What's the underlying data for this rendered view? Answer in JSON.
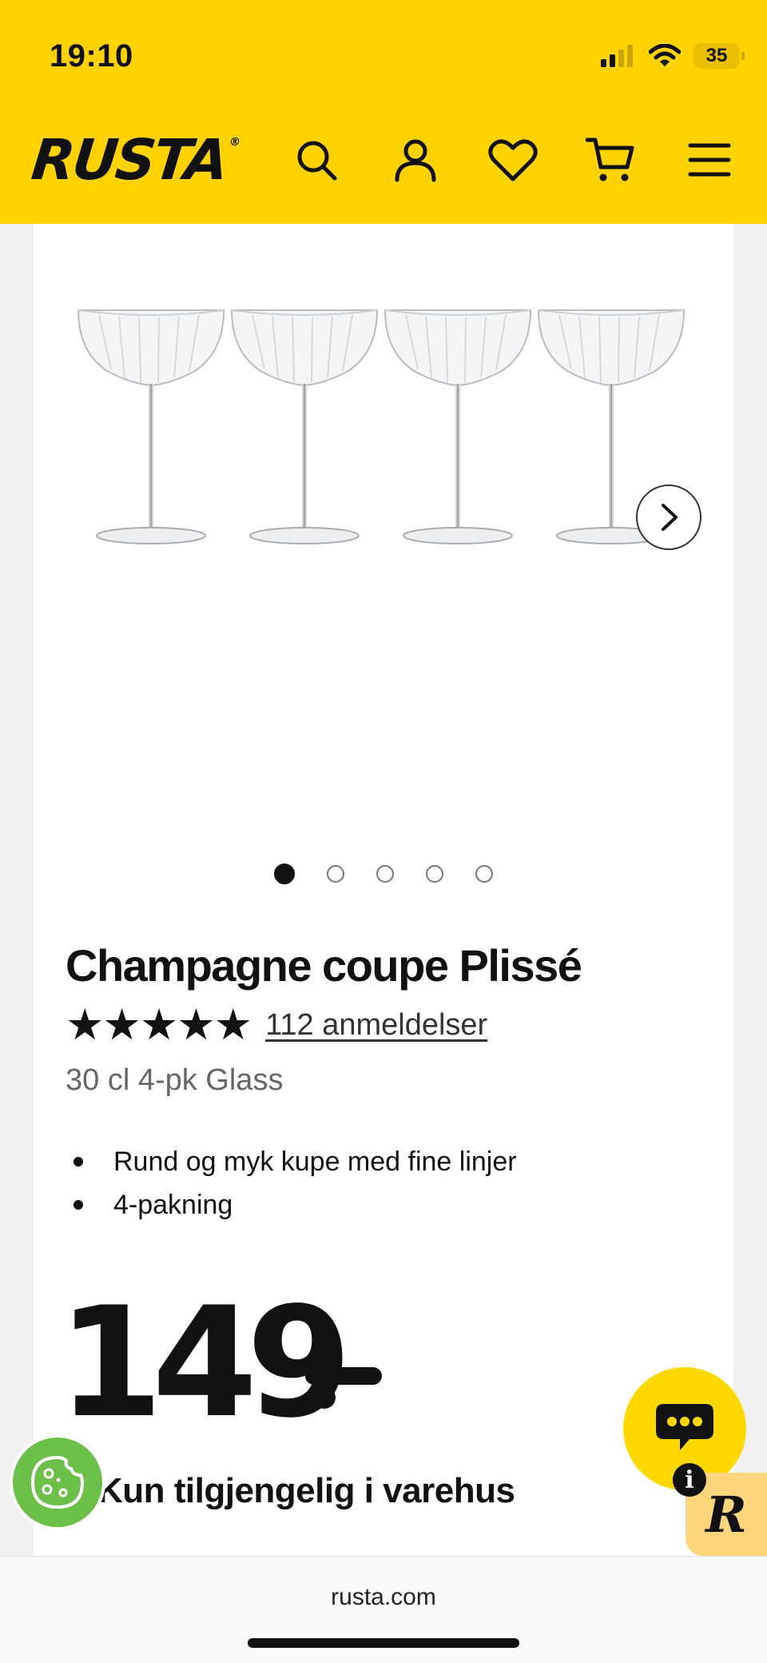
{
  "status_bar": {
    "time": "19:10",
    "battery": "35"
  },
  "header": {
    "logo": "RUSTA",
    "logo_mark": "®"
  },
  "product": {
    "title": "Champagne coupe Plissé",
    "stars": "★★★★★",
    "rating_value": 5,
    "reviews_link": "112 anmeldelser",
    "variant": "30 cl 4-pk Glass",
    "bullets": [
      "Rund og myk kupe med fine linjer",
      "4-pakning"
    ],
    "price": "149",
    "availability": "Kun tilgjengelig i varehus"
  },
  "gallery": {
    "image_count": 5,
    "active_index": 0
  },
  "browser": {
    "url": "rusta.com"
  },
  "colors": {
    "brand_yellow": "#ffd200",
    "cookie_green": "#6cc04a",
    "chat_yellow": "#ffd800",
    "r_badge": "#ffd67c"
  },
  "icons": [
    "signal-icon",
    "wifi-icon",
    "search-icon",
    "account-icon",
    "wishlist-heart-icon",
    "cart-icon",
    "menu-icon",
    "chevron-right-icon",
    "cookie-icon",
    "chat-icon",
    "info-icon"
  ]
}
